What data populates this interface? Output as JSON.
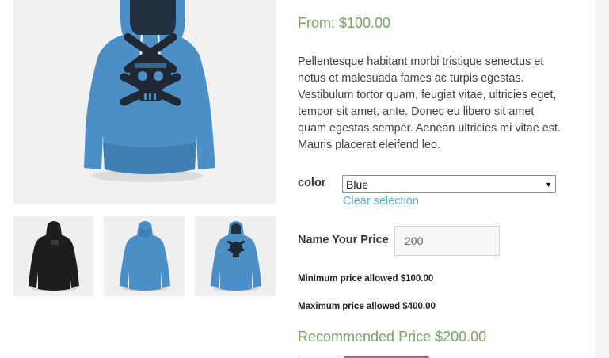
{
  "product": {
    "price": "From: $100.00",
    "description": "Pellentesque habitant morbi tristique senectus et netus et malesuada fames ac turpis egestas. Vestibulum tortor quam, feugiat vitae, ultricies eget, tempor sit amet, ante. Donec eu libero sit amet quam egestas semper. Aenean ultricies mi vitae est. Mauris placerat eleifend leo."
  },
  "variation": {
    "label": "color",
    "selected": "Blue",
    "clear_label": "Clear selection"
  },
  "name_your_price": {
    "label": "Name Your Price",
    "value": "200",
    "minimum": "Minimum price allowed $100.00",
    "maximum": "Maximum price allowed $400.00",
    "recommended": "Recommended Price $200.00"
  },
  "gallery": {
    "main_image": "blue-hoodie-with-skull-logo-image",
    "thumbnails": [
      "black-hoodie-back-thumbnail",
      "blue-hoodie-back-thumbnail",
      "blue-hoodie-front-thumbnail"
    ]
  },
  "colors": {
    "accent_green": "#77a464",
    "link_blue": "#5ab0d3",
    "hoodie_blue": "#4b8fc6",
    "button_purple": "#a46497"
  }
}
